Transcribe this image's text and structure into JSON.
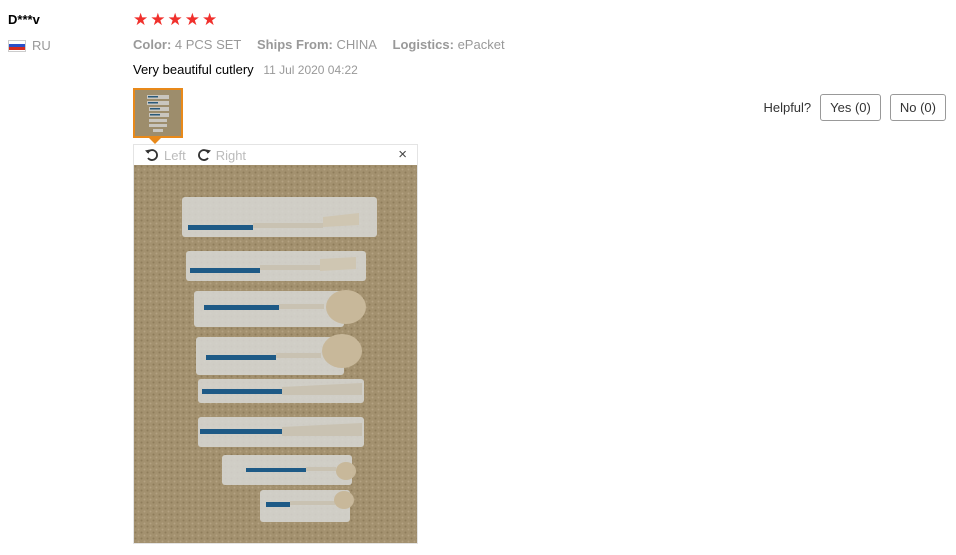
{
  "reviewer": {
    "name": "D***v",
    "country": "RU",
    "flag_icon": "russia-flag-icon"
  },
  "rating": {
    "stars": 5,
    "max": 5,
    "star_color": "#f0302c"
  },
  "specs": {
    "color_label": "Color:",
    "color_value": "4 PCS SET",
    "ships_label": "Ships From:",
    "ships_value": "CHINA",
    "logistics_label": "Logistics:",
    "logistics_value": "ePacket"
  },
  "review": {
    "text": "Very beautiful cutlery",
    "date": "11 Jul 2020 04:22"
  },
  "helpful": {
    "label": "Helpful?",
    "yes": "Yes (0)",
    "no": "No (0)"
  },
  "viewer": {
    "left": "Left",
    "right": "Right",
    "close": "×",
    "accent": "#e8891a"
  }
}
